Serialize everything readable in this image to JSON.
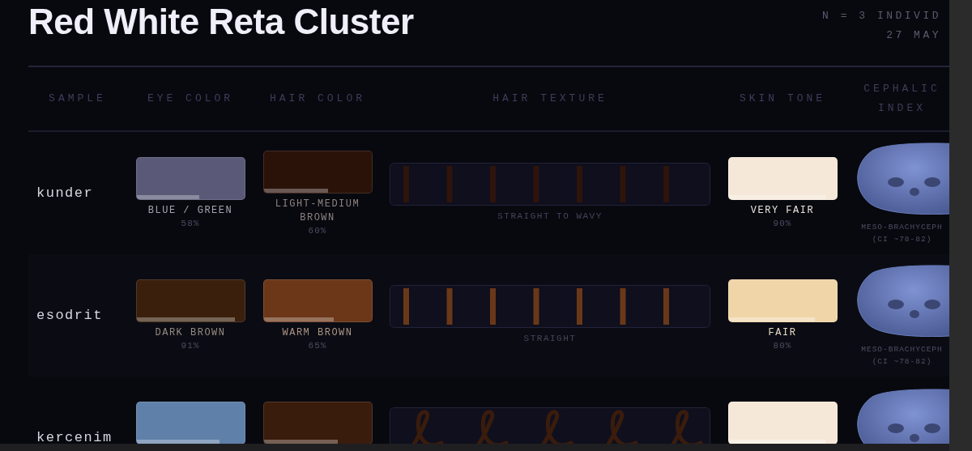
{
  "title": "Red White Reta Cluster",
  "meta": [
    "N = 3 INDIVID",
    "27 MAY"
  ],
  "columns": [
    "SAMPLE",
    "EYE COLOR",
    "HAIR COLOR",
    "HAIR TEXTURE",
    "SKIN TONE",
    "CEPHALIC INDEX"
  ],
  "rows": [
    {
      "sample": "kunder",
      "eye": {
        "label": "BLUE / GREEN",
        "percent": "58%",
        "color": "#5a5a78",
        "level": 0.58
      },
      "hair": {
        "label": "LIGHT-MEDIUM BROWN",
        "percent": "60%",
        "color": "#2a1208",
        "level": 0.6
      },
      "texture": {
        "kind": "straight",
        "label": "STRAIGHT TO WAVY",
        "color": "#2e140a"
      },
      "skin": {
        "label": "VERY FAIR",
        "percent": "90%",
        "color": "#f5e8d8",
        "level": 0.9
      },
      "cephalic": {
        "label": "MESO-BRACHYCEPH",
        "index": "(CI ~78-82)"
      }
    },
    {
      "sample": "esodrit",
      "eye": {
        "label": "DARK BROWN",
        "percent": "91%",
        "color": "#3a200c",
        "level": 0.91
      },
      "hair": {
        "label": "WARM BROWN",
        "percent": "65%",
        "color": "#6b3718",
        "level": 0.65
      },
      "texture": {
        "kind": "straight",
        "label": "STRAIGHT",
        "color": "#6a3818"
      },
      "skin": {
        "label": "FAIR",
        "percent": "80%",
        "color": "#efd5a8",
        "level": 0.8
      },
      "cephalic": {
        "label": "MESO-BRACHYCEPH",
        "index": "(CI ~78-82)"
      }
    },
    {
      "sample": "kercenim",
      "eye": {
        "color": "#5f80a8",
        "level": 0.77
      },
      "hair": {
        "color": "#3a1c0c",
        "level": 0.69
      },
      "texture": {
        "kind": "curly",
        "color": "#3a1c0c"
      },
      "skin": {
        "color": "#f5e8d8",
        "level": 0.9
      },
      "cephalic": {}
    }
  ]
}
